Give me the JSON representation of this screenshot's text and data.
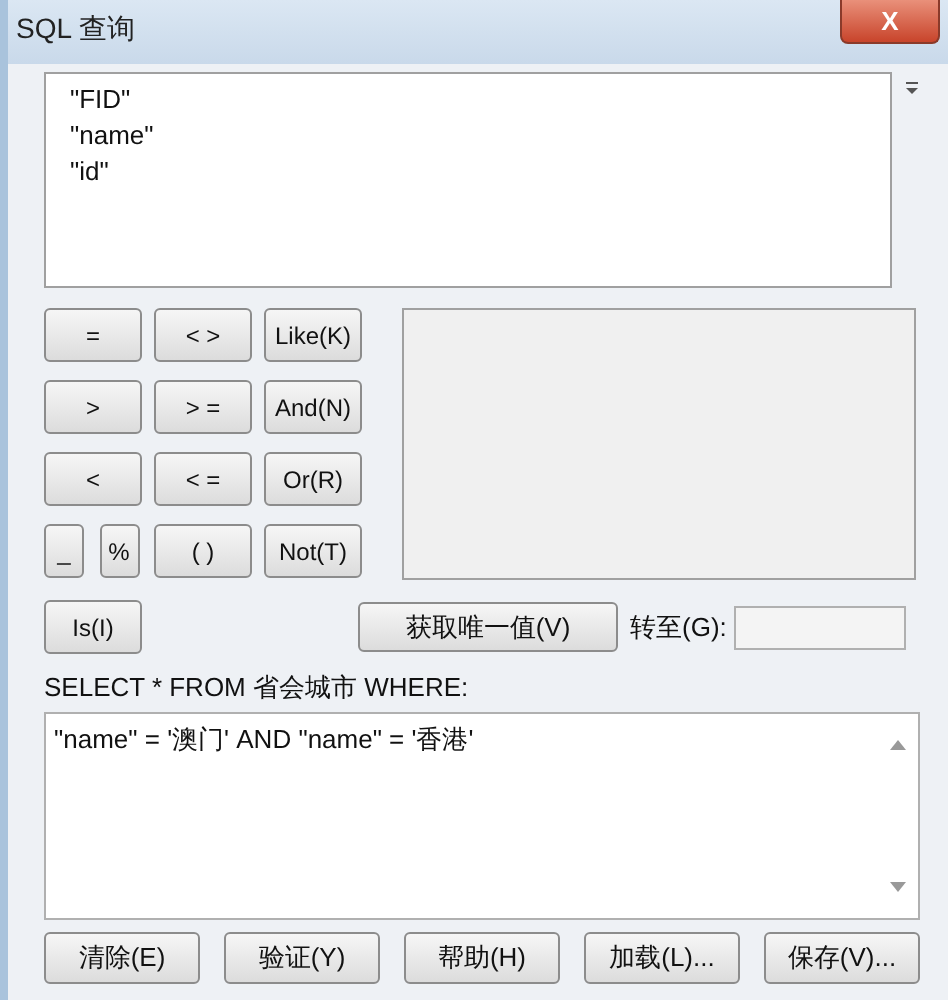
{
  "window": {
    "title": "SQL 查询",
    "close": "X"
  },
  "fields": [
    "\"FID\"",
    "\"name\"",
    "\"id\""
  ],
  "operators": [
    {
      "label": "=",
      "kind": "wide"
    },
    {
      "label": "< >",
      "kind": "wide"
    },
    {
      "label": "Like(K)",
      "kind": "wide"
    },
    {
      "label": ">",
      "kind": "wide"
    },
    {
      "label": "> =",
      "kind": "wide"
    },
    {
      "label": "And(N)",
      "kind": "wide"
    },
    {
      "label": "<",
      "kind": "wide"
    },
    {
      "label": "< =",
      "kind": "wide"
    },
    {
      "label": "Or(R)",
      "kind": "wide"
    },
    {
      "label": "_",
      "kind": "half"
    },
    {
      "label": "%",
      "kind": "half"
    },
    {
      "label": "( )",
      "kind": "wide"
    },
    {
      "label": "Not(T)",
      "kind": "wide"
    }
  ],
  "is_button": "Is(I)",
  "unique_button": "获取唯一值(V)",
  "goto_label": "转至(G):",
  "query_label": "SELECT * FROM 省会城市 WHERE:",
  "query_text": "\"name\" = '澳门' AND \"name\" = '香港'",
  "buttons": [
    "清除(E)",
    "验证(Y)",
    "帮助(H)",
    "加载(L)...",
    "保存(V)..."
  ]
}
